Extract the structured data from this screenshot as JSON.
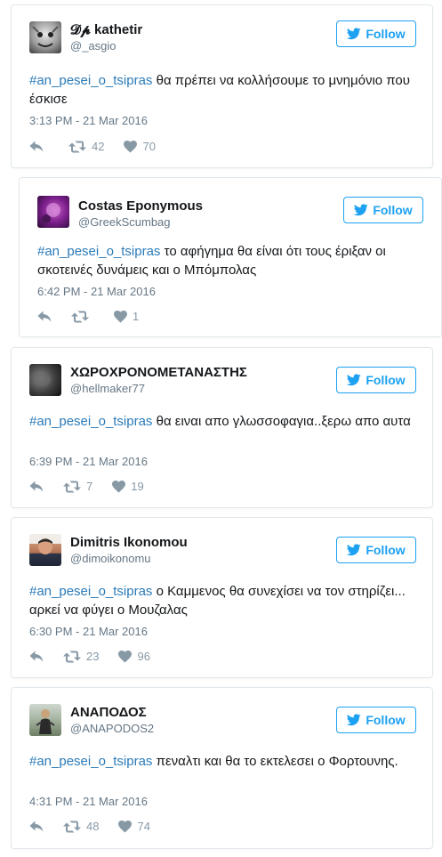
{
  "follow_label": "Follow",
  "colors": {
    "accent": "#1da1f2",
    "hashtag": "#2b7bb9",
    "muted": "#657786"
  },
  "tweets": [
    {
      "display_name": "𝓓𝓹 kathetir",
      "handle": "@_asgio",
      "hashtag": "#an_pesei_o_tsipras",
      "text": " θα πρέπει να κολλήσουμε το μνημόνιο που έσκισε",
      "timestamp": "3:13 PM - 21 Mar 2016",
      "retweets": "42",
      "likes": "70"
    },
    {
      "display_name": "Costas Eponymous",
      "handle": "@GreekScumbag",
      "hashtag": "#an_pesei_o_tsipras",
      "text": " το αφήγημα θα είναι ότι τους έριξαν οι σκοτεινές δυνάμεις και ο Μπόμπολας",
      "timestamp": "6:42 PM - 21 Mar 2016",
      "retweets": "",
      "likes": "1"
    },
    {
      "display_name": "ΧΩΡΟΧΡΟΝΟΜΕΤΑΝΑΣΤΗΣ",
      "handle": "@hellmaker77",
      "hashtag": "#an_pesei_o_tsipras",
      "text": " θα ειναι απο γλωσσοφαγια..ξερω απο αυτα",
      "timestamp": "6:39 PM - 21 Mar 2016",
      "retweets": "7",
      "likes": "19"
    },
    {
      "display_name": "Dimitris Ikonomou",
      "handle": "@dimoikonomu",
      "hashtag": "#an_pesei_o_tsipras",
      "text": " ο Καμμενος θα συνεχίσει να τον στηρίζει... αρκεί να φύγει ο Μουζαλας",
      "timestamp": "6:30 PM - 21 Mar 2016",
      "retweets": "23",
      "likes": "96"
    },
    {
      "display_name": "ΑΝΑΠΟΔΟΣ",
      "handle": "@ANAPODOS2",
      "hashtag": "#an_pesei_o_tsipras",
      "text": " πεναλτι και θα το εκτελεσει ο Φορτουνης.",
      "timestamp": "4:31 PM - 21 Mar 2016",
      "retweets": "48",
      "likes": "74"
    }
  ]
}
